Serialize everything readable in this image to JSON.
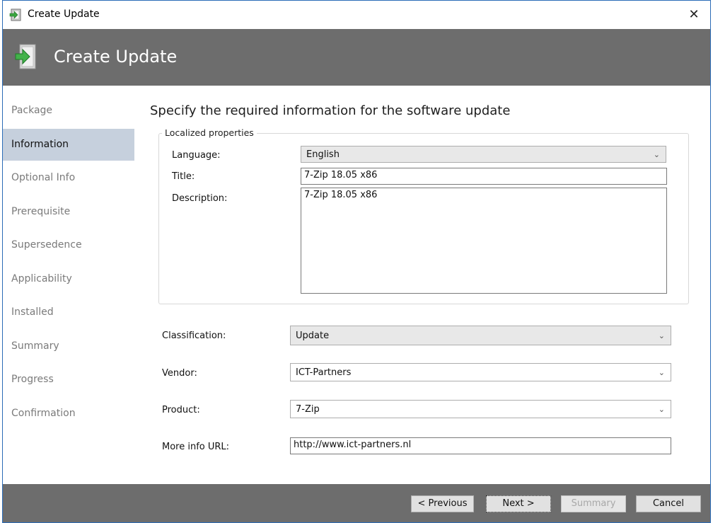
{
  "window": {
    "title": "Create Update",
    "close_glyph": "✕"
  },
  "header": {
    "title": "Create Update",
    "icon": "package-arrow-icon"
  },
  "sidebar": {
    "items": [
      {
        "label": "Package"
      },
      {
        "label": "Information",
        "active": true
      },
      {
        "label": "Optional Info"
      },
      {
        "label": "Prerequisite"
      },
      {
        "label": "Supersedence"
      },
      {
        "label": "Applicability"
      },
      {
        "label": "Installed"
      },
      {
        "label": "Summary"
      },
      {
        "label": "Progress"
      },
      {
        "label": "Confirmation"
      }
    ]
  },
  "main": {
    "heading": "Specify the required information for the software update",
    "localized": {
      "legend": "Localized properties",
      "language_label": "Language:",
      "language_value": "English",
      "title_label": "Title:",
      "title_value": "7-Zip 18.05 x86",
      "description_label": "Description:",
      "description_value": "7-Zip 18.05 x86"
    },
    "classification_label": "Classification:",
    "classification_value": "Update",
    "vendor_label": "Vendor:",
    "vendor_value": "ICT-Partners",
    "product_label": "Product:",
    "product_value": "7-Zip",
    "url_label": "More info URL:",
    "url_value": "http://www.ict-partners.nl"
  },
  "footer": {
    "previous": "< Previous",
    "next": "Next >",
    "summary": "Summary",
    "cancel": "Cancel"
  },
  "colors": {
    "header_bg": "#6d6d6d",
    "active_nav_bg": "#c6d0dd",
    "accent_border": "#2b6cb7"
  }
}
